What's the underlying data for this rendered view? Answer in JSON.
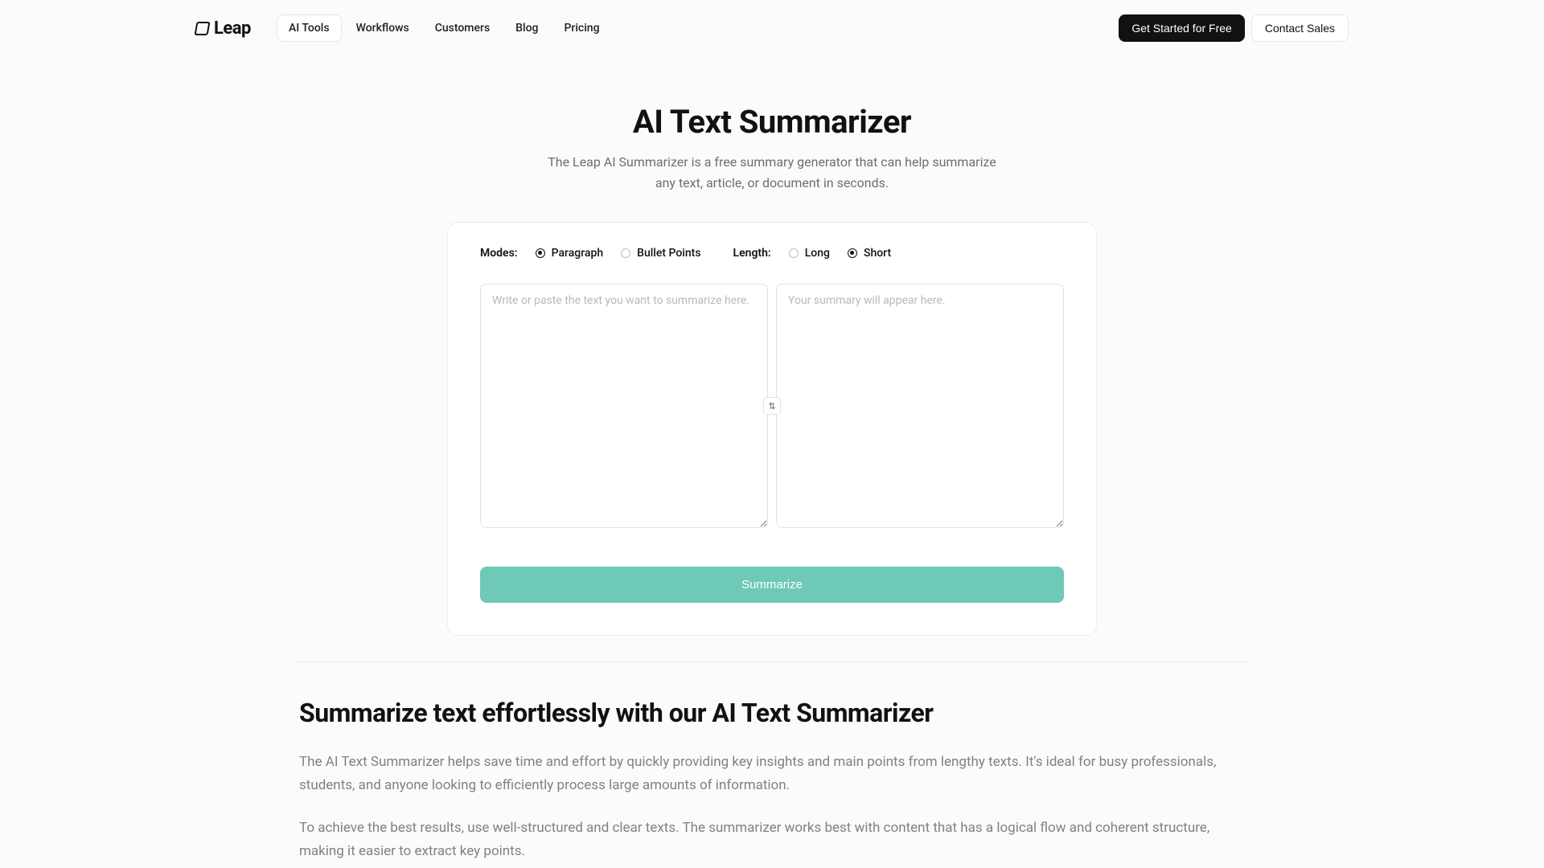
{
  "brand": {
    "name": "Leap"
  },
  "nav": {
    "items": [
      {
        "label": "AI Tools",
        "active": true
      },
      {
        "label": "Workflows",
        "active": false
      },
      {
        "label": "Customers",
        "active": false
      },
      {
        "label": "Blog",
        "active": false
      },
      {
        "label": "Pricing",
        "active": false
      }
    ]
  },
  "header_actions": {
    "primary": "Get Started for Free",
    "secondary": "Contact Sales"
  },
  "hero": {
    "title": "AI Text Summarizer",
    "subtitle": "The Leap AI Summarizer is a free summary generator that can help summarize any text, article, or document in seconds."
  },
  "tool": {
    "modes_label": "Modes:",
    "modes": [
      {
        "label": "Paragraph",
        "selected": true
      },
      {
        "label": "Bullet Points",
        "selected": false
      }
    ],
    "length_label": "Length:",
    "lengths": [
      {
        "label": "Long",
        "selected": false
      },
      {
        "label": "Short",
        "selected": true
      }
    ],
    "input_placeholder": "Write or paste the text you want to summarize here.",
    "output_placeholder": "Your summary will appear here.",
    "swap_icon": "⇅",
    "button": "Summarize"
  },
  "content": {
    "heading": "Summarize text effortlessly with our AI Text Summarizer",
    "p1": "The AI Text Summarizer helps save time and effort by quickly providing key insights and main points from lengthy texts. It's ideal for busy professionals, students, and anyone looking to efficiently process large amounts of information.",
    "p2": "To achieve the best results, use well-structured and clear texts. The summarizer works best with content that has a logical flow and coherent structure, making it easier to extract key points."
  }
}
